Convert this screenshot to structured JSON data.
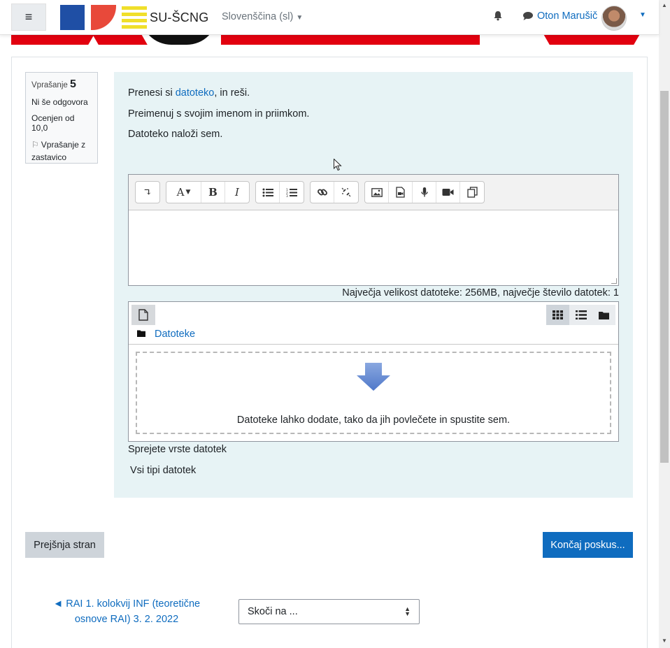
{
  "navbar": {
    "menu_icon": "hamburger-icon",
    "brand": "SU-ŠCNG",
    "language": "Slovenščina (sl)",
    "notifications_icon": "bell-icon",
    "messages_icon": "chat-icon",
    "user_name": "Oton Marušič"
  },
  "question_info": {
    "label": "Vprašanje",
    "number": "5",
    "state": "Ni še odgovora",
    "grade": "Ocenjen od 10,0",
    "flag_label": "Vprašanje z zastavico"
  },
  "question": {
    "line1_prefix": "Prenesi si ",
    "line1_link": "datoteko",
    "line1_suffix": ", in reši.",
    "line2": "Preimenuj s svojim imenom in priimkom.",
    "line3": "Datoteko naloži sem."
  },
  "editor": {
    "toolbar_buttons": [
      "expand-icon",
      "font-color-icon",
      "bold-icon",
      "italic-icon",
      "unordered-list-icon",
      "ordered-list-icon",
      "link-icon",
      "unlink-icon",
      "image-icon",
      "media-icon",
      "record-audio-icon",
      "record-video-icon",
      "manage-files-icon"
    ]
  },
  "filepicker": {
    "max_size_text": "Največja velikost datoteke: 256MB, največje število datotek: 1",
    "path_label": "Datoteke",
    "drop_text": "Datoteke lahko dodate, tako da jih povlečete in spustite sem.",
    "accepted_label": "Sprejete vrste datotek",
    "accepted_value": "Vsi tipi datotek"
  },
  "navigation": {
    "prev_label": "Prejšnja stran",
    "finish_label": "Končaj poskus...",
    "back_link": "◄ RAI 1. kolokvij INF (teoretične osnove RAI) 3. 2. 2022",
    "jump_placeholder": "Skoči na ..."
  },
  "colors": {
    "primary": "#0f6cbf",
    "question_bg": "#e7f3f5",
    "secondary_btn": "#ced4da"
  }
}
